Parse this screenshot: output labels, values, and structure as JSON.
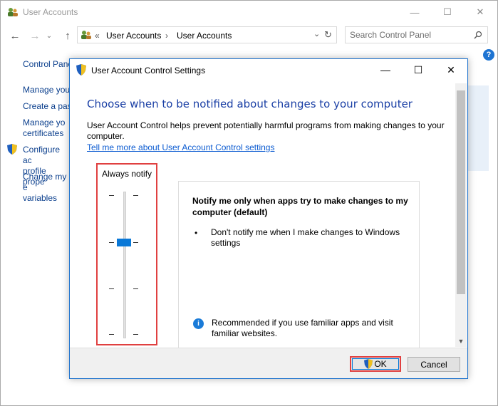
{
  "outer": {
    "title": "User Accounts",
    "breadcrumb_prefix": "«",
    "breadcrumb": [
      "User Accounts",
      "User Accounts"
    ],
    "breadcrumb_sep": "›",
    "search_placeholder": "Search Control Panel"
  },
  "sidebar": {
    "control_panel": "Control Pane",
    "items": [
      {
        "label": "Manage you"
      },
      {
        "label": "Create a pass"
      },
      {
        "label": "Manage yo\ncertificates"
      },
      {
        "label": "Configure ac\nprofile prope"
      },
      {
        "label": "Change my e\nvariables"
      }
    ]
  },
  "dialog": {
    "title": "User Account Control Settings",
    "heading": "Choose when to be notified about changes to your computer",
    "description": "User Account Control helps prevent potentially harmful programs from making changes to your computer.",
    "link": "Tell me more about User Account Control settings",
    "slider": {
      "top_label": "Always notify",
      "levels": 4,
      "selected_level": 2
    },
    "info": {
      "title": "Notify me only when apps try to make changes to my computer (default)",
      "bullet": "Don't notify me when I make changes to Windows settings",
      "recommendation": "Recommended if you use familiar apps and visit familiar websites."
    },
    "buttons": {
      "ok": "OK",
      "cancel": "Cancel"
    }
  },
  "colors": {
    "accent": "#1f73cd",
    "heading": "#1a3fa5",
    "highlight": "#e04040",
    "thumb": "#0a78d7"
  }
}
